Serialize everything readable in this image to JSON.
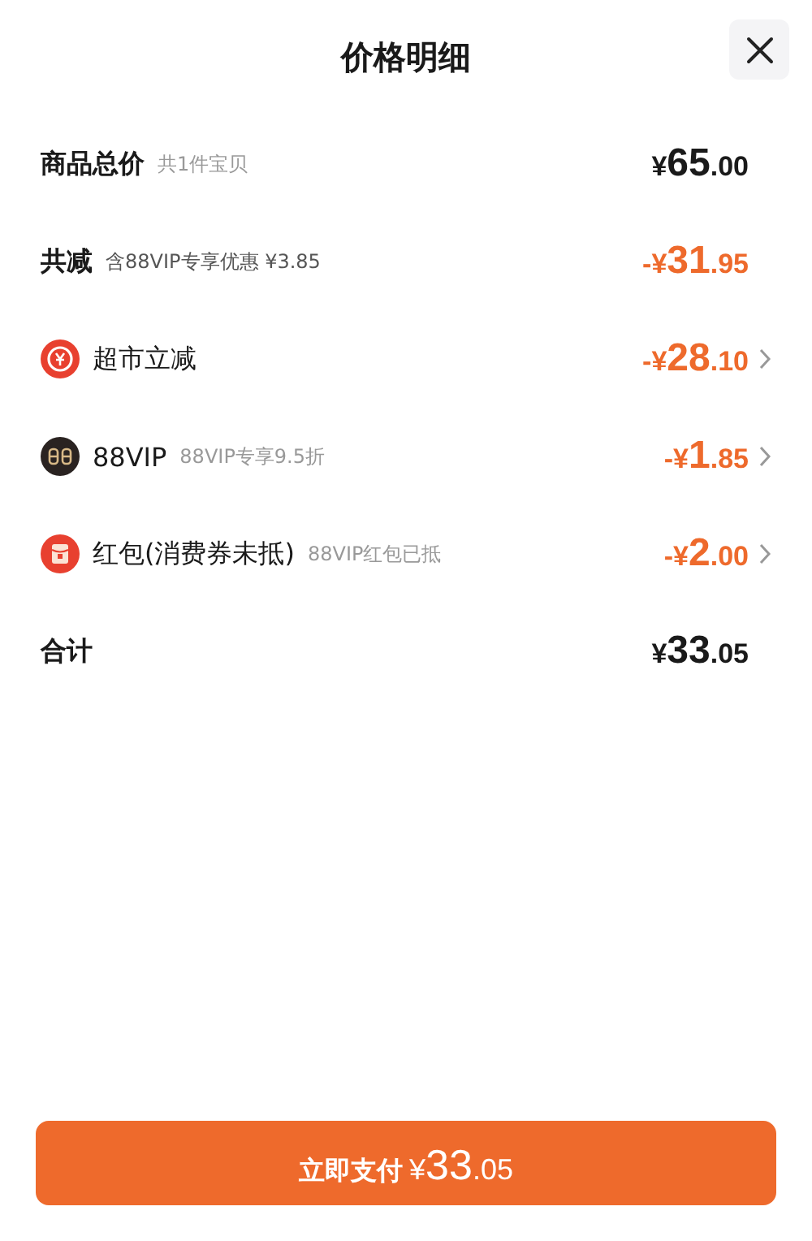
{
  "header": {
    "title": "价格明细"
  },
  "rows": [
    {
      "kind": "total",
      "label": "商品总价",
      "note": "共1件宝贝",
      "amount": {
        "currency": "¥",
        "integer": "65",
        "decimal": ".00"
      },
      "expandable": false
    },
    {
      "kind": "discount",
      "label": "共减",
      "note": "含88VIP专享优惠 ¥3.85",
      "amount": {
        "sign": "-",
        "currency": "¥",
        "integer": "31",
        "decimal": ".95"
      },
      "expandable": false
    },
    {
      "kind": "coupon",
      "label": "超市立减",
      "amount": {
        "sign": "-",
        "currency": "¥",
        "integer": "28",
        "decimal": ".10"
      },
      "expandable": true
    },
    {
      "kind": "vip",
      "label": "88VIP",
      "note": "88VIP专享9.5折",
      "amount": {
        "sign": "-",
        "currency": "¥",
        "integer": "1",
        "decimal": ".85"
      },
      "expandable": true
    },
    {
      "kind": "packet",
      "label": "红包(消费券未抵)",
      "note": "88VIP红包已抵",
      "amount": {
        "sign": "-",
        "currency": "¥",
        "integer": "2",
        "decimal": ".00"
      },
      "expandable": true
    },
    {
      "kind": "total",
      "label": "合计",
      "amount": {
        "currency": "¥",
        "integer": "33",
        "decimal": ".05"
      },
      "expandable": false
    }
  ],
  "pay_button": {
    "label": "立即支付",
    "amount": {
      "currency": "¥",
      "integer": "33",
      "decimal": ".05"
    }
  }
}
